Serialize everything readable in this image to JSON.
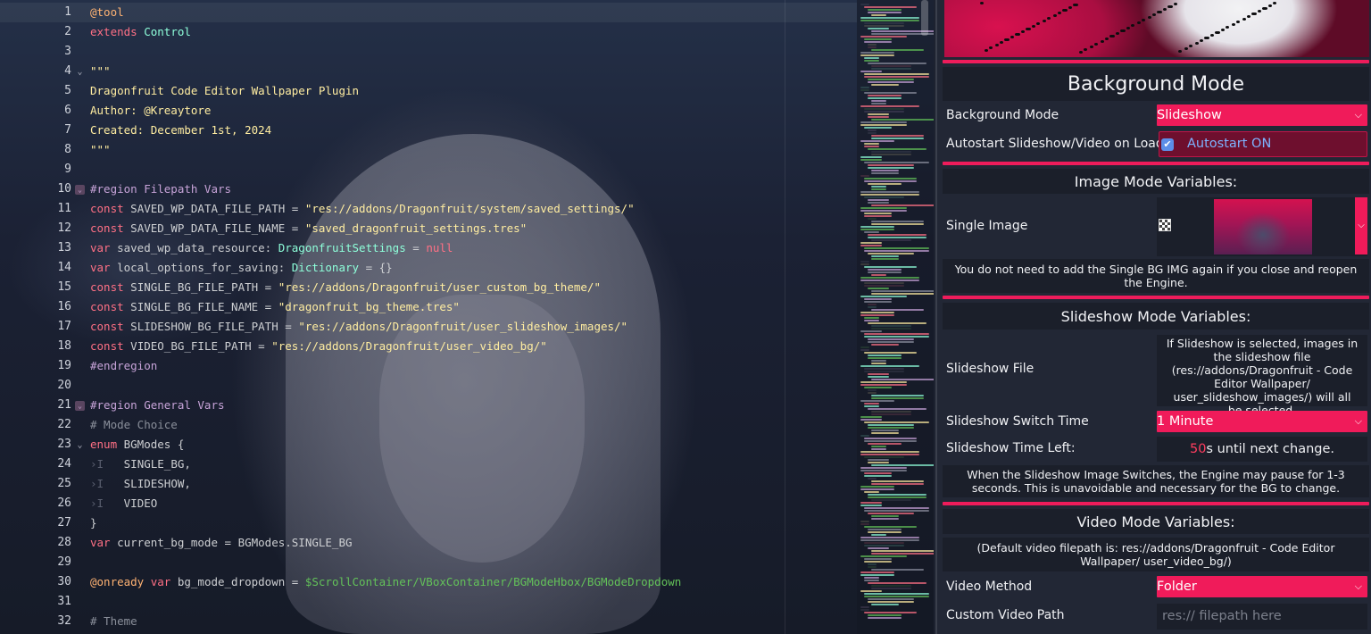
{
  "code": {
    "lines": [
      {
        "n": "1",
        "parts": [
          [
            "ann",
            "@tool"
          ]
        ]
      },
      {
        "n": "2",
        "parts": [
          [
            "k",
            "extends"
          ],
          [
            "p",
            " "
          ],
          [
            "t",
            "Control"
          ]
        ]
      },
      {
        "n": "3",
        "parts": []
      },
      {
        "n": "4",
        "fold": "open",
        "parts": [
          [
            "s",
            "\"\"\""
          ]
        ]
      },
      {
        "n": "5",
        "parts": [
          [
            "s",
            "Dragonfruit Code Editor Wallpaper Plugin"
          ]
        ]
      },
      {
        "n": "6",
        "parts": [
          [
            "s",
            "Author: @Kreaytore"
          ]
        ]
      },
      {
        "n": "7",
        "parts": [
          [
            "s",
            "Created: December 1st, 2024"
          ]
        ]
      },
      {
        "n": "8",
        "parts": [
          [
            "s",
            "\"\"\""
          ]
        ]
      },
      {
        "n": "9",
        "parts": []
      },
      {
        "n": "10",
        "fold": "closed",
        "parts": [
          [
            "r",
            "#region Filepath Vars"
          ]
        ]
      },
      {
        "n": "11",
        "parts": [
          [
            "k",
            "const"
          ],
          [
            "p",
            " SAVED_WP_DATA_FILE_PATH = "
          ],
          [
            "s",
            "\"res://addons/Dragonfruit/system/saved_settings/\""
          ]
        ]
      },
      {
        "n": "12",
        "parts": [
          [
            "k",
            "const"
          ],
          [
            "p",
            " SAVED_WP_DATA_FILE_NAME = "
          ],
          [
            "s",
            "\"saved_dragonfruit_settings.tres\""
          ]
        ]
      },
      {
        "n": "13",
        "parts": [
          [
            "k",
            "var"
          ],
          [
            "p",
            " saved_wp_data_resource: "
          ],
          [
            "t",
            "DragonfruitSettings"
          ],
          [
            "p",
            " = "
          ],
          [
            "n",
            "null"
          ]
        ]
      },
      {
        "n": "14",
        "parts": [
          [
            "k",
            "var"
          ],
          [
            "p",
            " local_options_for_saving: "
          ],
          [
            "t",
            "Dictionary"
          ],
          [
            "p",
            " = {}"
          ]
        ]
      },
      {
        "n": "15",
        "parts": [
          [
            "k",
            "const"
          ],
          [
            "p",
            " SINGLE_BG_FILE_PATH = "
          ],
          [
            "s",
            "\"res://addons/Dragonfruit/user_custom_bg_theme/\""
          ]
        ]
      },
      {
        "n": "16",
        "parts": [
          [
            "k",
            "const"
          ],
          [
            "p",
            " SINGLE_BG_FILE_NAME = "
          ],
          [
            "s",
            "\"dragonfruit_bg_theme.tres\""
          ]
        ]
      },
      {
        "n": "17",
        "parts": [
          [
            "k",
            "const"
          ],
          [
            "p",
            " SLIDESHOW_BG_FILE_PATH = "
          ],
          [
            "s",
            "\"res://addons/Dragonfruit/user_slideshow_images/\""
          ]
        ]
      },
      {
        "n": "18",
        "parts": [
          [
            "k",
            "const"
          ],
          [
            "p",
            " VIDEO_BG_FILE_PATH = "
          ],
          [
            "s",
            "\"res://addons/Dragonfruit/user_video_bg/\""
          ]
        ]
      },
      {
        "n": "19",
        "parts": [
          [
            "r",
            "#endregion"
          ]
        ]
      },
      {
        "n": "20",
        "parts": []
      },
      {
        "n": "21",
        "fold": "closed",
        "parts": [
          [
            "r",
            "#region General Vars"
          ]
        ]
      },
      {
        "n": "22",
        "parts": [
          [
            "c",
            "# Mode Choice"
          ]
        ]
      },
      {
        "n": "23",
        "fold": "open",
        "parts": [
          [
            "k",
            "enum"
          ],
          [
            "p",
            " BGModes {"
          ]
        ]
      },
      {
        "n": "24",
        "parts": [
          [
            "tab",
            "›I"
          ],
          [
            "p",
            "   SINGLE_BG,"
          ]
        ]
      },
      {
        "n": "25",
        "parts": [
          [
            "tab",
            "›I"
          ],
          [
            "p",
            "   SLIDESHOW,"
          ]
        ]
      },
      {
        "n": "26",
        "parts": [
          [
            "tab",
            "›I"
          ],
          [
            "p",
            "   VIDEO"
          ]
        ]
      },
      {
        "n": "27",
        "parts": [
          [
            "p",
            "}"
          ]
        ]
      },
      {
        "n": "28",
        "parts": [
          [
            "k",
            "var"
          ],
          [
            "p",
            " current_bg_mode = BGModes.SINGLE_BG"
          ]
        ]
      },
      {
        "n": "29",
        "parts": []
      },
      {
        "n": "30",
        "parts": [
          [
            "ann",
            "@onready"
          ],
          [
            "p",
            " "
          ],
          [
            "k",
            "var"
          ],
          [
            "p",
            " bg_mode_dropdown = "
          ],
          [
            "np",
            "$ScrollContainer/VBoxContainer/BGModeHbox/BGModeDropdown"
          ]
        ]
      },
      {
        "n": "31",
        "parts": []
      },
      {
        "n": "32",
        "parts": [
          [
            "c",
            "# Theme"
          ]
        ]
      }
    ]
  },
  "panel": {
    "background_mode": {
      "heading": "Background Mode",
      "mode_label": "Background Mode",
      "mode_value": "Slideshow",
      "autostart_label": "Autostart Slideshow/Video on Load",
      "autostart_checked": true,
      "autostart_text": "Autostart ON"
    },
    "image_mode": {
      "heading": "Image Mode Variables:",
      "single_image_label": "Single Image",
      "note": "You do not need to add the Single BG IMG again if you close and reopen the Engine."
    },
    "slideshow_mode": {
      "heading": "Slideshow Mode Variables:",
      "file_label": "Slideshow File",
      "file_info": "If Slideshow is selected, images in the slideshow file (res://addons/Dragonfruit - Code Editor Wallpaper/ user_slideshow_images/) will all be selected.",
      "switch_time_label": "Slideshow Switch Time",
      "switch_time_value": "1 Minute",
      "time_left_label": "Slideshow Time Left:",
      "time_left_value": "50",
      "time_left_suffix": "s until next change.",
      "note": "When the Slideshow Image Switches, the Engine may pause for 1-3 seconds. This is unavoidable and necessary for the BG to change."
    },
    "video_mode": {
      "heading": "Video Mode Variables:",
      "default_path_note": "(Default video filepath is: res://addons/Dragonfruit - Code Editor Wallpaper/ user_video_bg/)",
      "method_label": "Video Method",
      "method_value": "Folder",
      "custom_path_label": "Custom Video Path",
      "custom_path_placeholder": "res:// filepath here",
      "custom_path_value": ""
    }
  },
  "colors": {
    "accent": "#f01b5a",
    "panel_bg": "#222735",
    "section_bg": "#1b1f2a",
    "checkbox_label": "#7db3ff"
  },
  "icons": {
    "fold_closed": "region-fold-icon",
    "fold_open": "chevron-down-icon",
    "dropdown": "chevron-down-icon",
    "checkbox": "check-icon",
    "image_clear": "checker-icon"
  }
}
